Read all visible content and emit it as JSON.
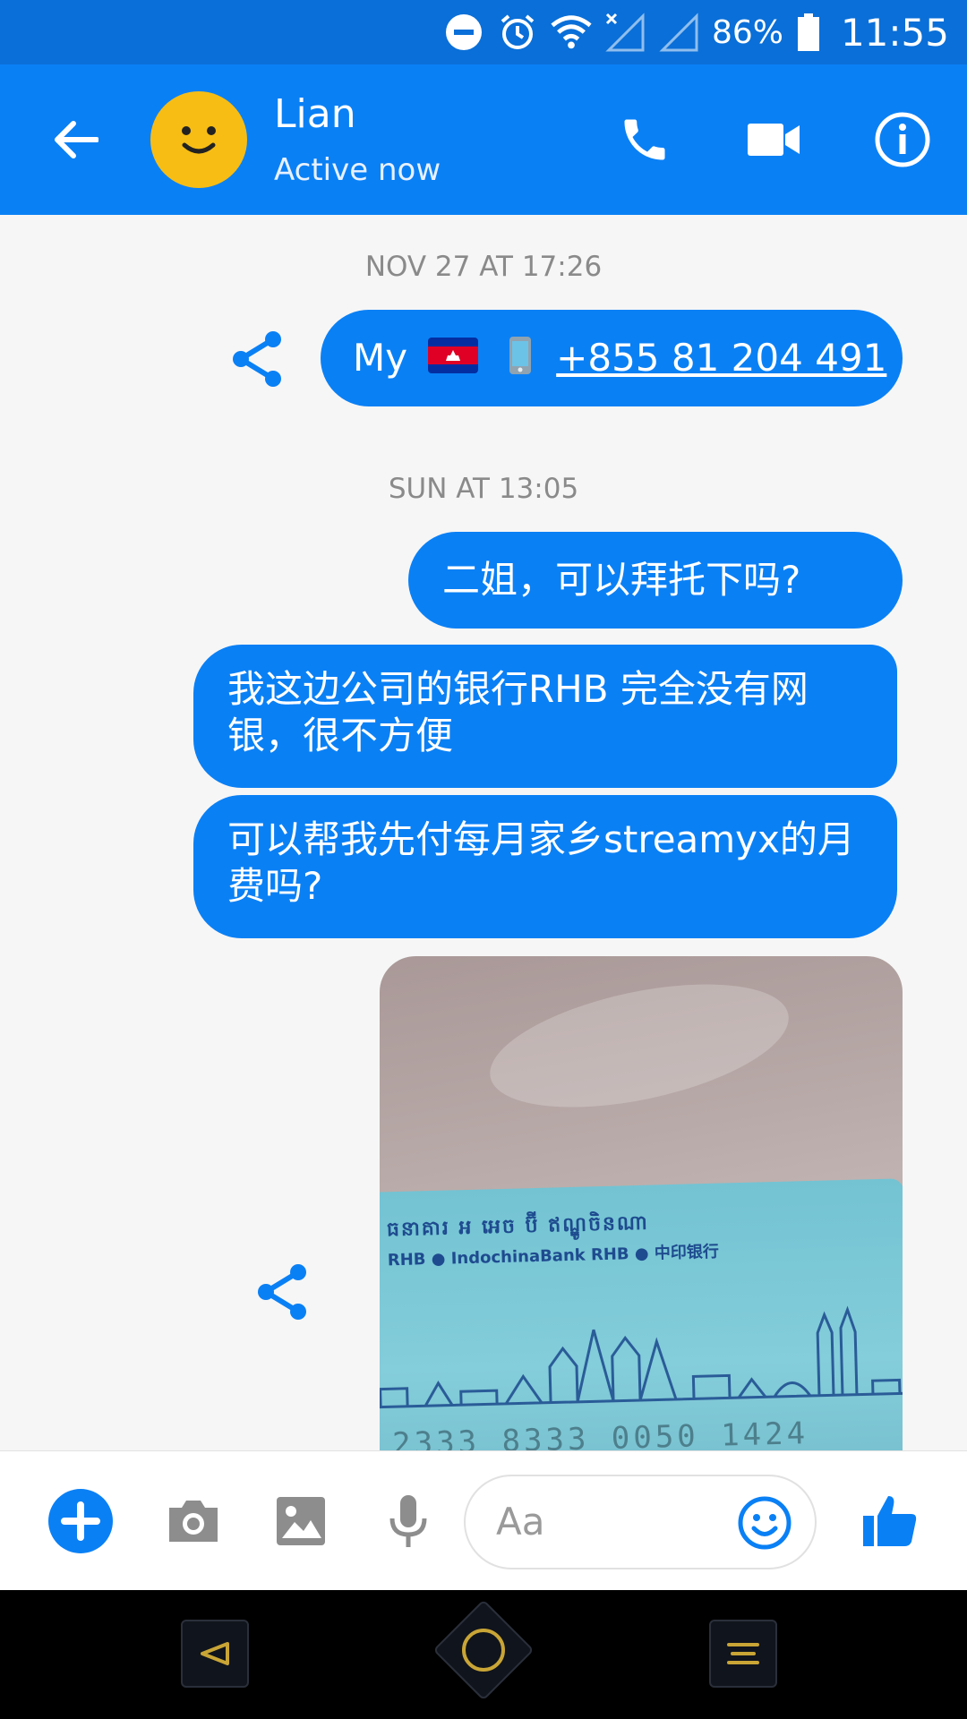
{
  "status_bar": {
    "battery_percent": "86%",
    "time": "11:55"
  },
  "header": {
    "contact_name": "Lian",
    "contact_status": "Active now"
  },
  "chat": {
    "messages": [
      {
        "timestamp": "NOV 27 AT 17:26",
        "prefix": "My",
        "phone": "+855 81 204 491"
      },
      {
        "timestamp": "SUN AT 13:05",
        "text": "二姐，可以拜托下吗?"
      },
      {
        "text": "我这边公司的银行RHB 完全没有网银，很不方便"
      },
      {
        "text": "可以帮我先付每月家乡streamyx的月费吗?"
      }
    ],
    "photo": {
      "card_line1": "ធនាគារ អ អេច ប៊ី ឥណ្ឌូចិនណា",
      "card_line2": "RHB ● IndochinaBank   RHB ● 中印银行",
      "card_number": "2333 8333 0050 1424"
    }
  },
  "composer": {
    "placeholder": "Aa"
  },
  "colors": {
    "brand_blue": "#0a80f5",
    "status_bar_blue": "#0a6fd8",
    "avatar_yellow": "#f7bd15"
  },
  "icons": [
    "minus-circle-icon",
    "alarm-icon",
    "wifi-icon",
    "signal-icon",
    "battery-icon",
    "back-arrow-icon",
    "phone-icon",
    "video-icon",
    "info-icon",
    "share-icon",
    "add-icon",
    "camera-icon",
    "gallery-icon",
    "microphone-icon",
    "emoji-icon",
    "thumbs-up-icon"
  ]
}
